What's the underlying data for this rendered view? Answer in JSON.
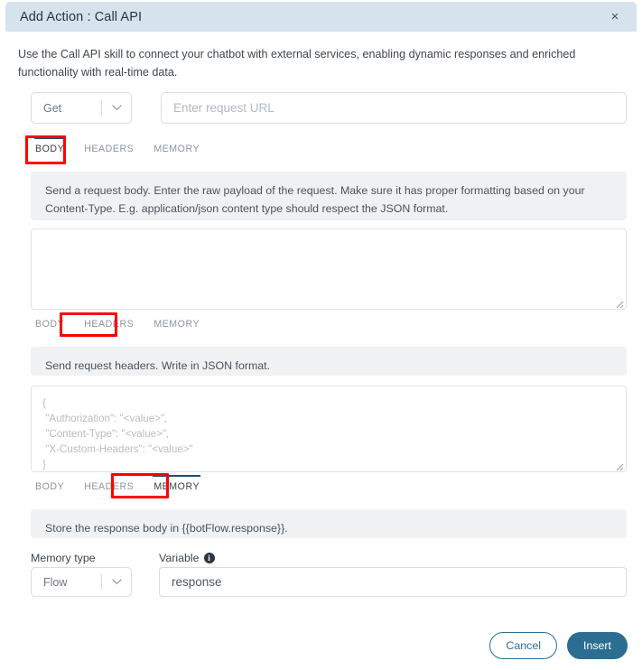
{
  "header": {
    "title": "Add Action : Call API",
    "close_label": "×",
    "bg_color": "#d6e3ec"
  },
  "intro": {
    "text": "Use the Call API skill to connect your chatbot with external services, enabling dynamic responses and enriched functionality with real-time data."
  },
  "request": {
    "method_label": "Get",
    "url_placeholder": "Enter request URL"
  },
  "tabs": {
    "body_label": "BODY",
    "headers_label": "HEADERS",
    "memory_label": "MEMORY"
  },
  "body_section": {
    "description": "Send a request body. Enter the raw payload of the request. Make sure it has proper formatting based on your Content-Type. E.g. application/json content type should respect the JSON format.",
    "textarea_value": ""
  },
  "headers_section": {
    "description": "Send request headers. Write in JSON format.",
    "textarea_placeholder": "{\n \"Authorization\": \"<value>\",\n \"Content-Type\": \"<value>\",\n \"X-Custom-Headers\": \"<value>\"\n}"
  },
  "memory_section": {
    "description": "Store the response body in {{botFlow.response}}.",
    "memory_type_label": "Memory type",
    "memory_type_value": "Flow",
    "variable_label": "Variable",
    "variable_value": "response"
  },
  "footer": {
    "cancel_label": "Cancel",
    "insert_label": "Insert",
    "insert_color": "#2b6e92",
    "cancel_color": "#2b7096"
  },
  "annotation": {
    "color": "#ff0000"
  }
}
